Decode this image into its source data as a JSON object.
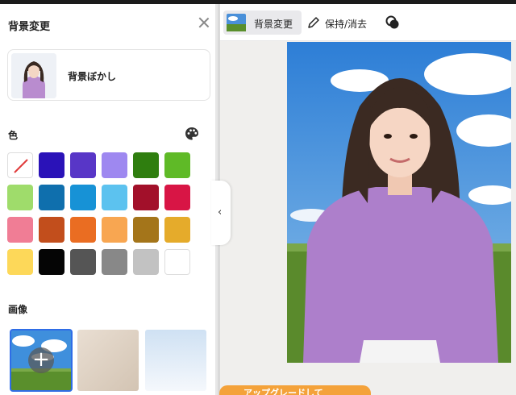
{
  "panel": {
    "title": "背景変更",
    "blur_label": "背景ぼかし",
    "color_label": "色",
    "image_label": "画像"
  },
  "swatches": [
    {
      "name": "none",
      "color": "#ffffff"
    },
    {
      "name": "dark-blue",
      "color": "#2a12b8"
    },
    {
      "name": "purple",
      "color": "#5836c7"
    },
    {
      "name": "lavender",
      "color": "#9e88f0"
    },
    {
      "name": "dark-green",
      "color": "#2f7e0f"
    },
    {
      "name": "green",
      "color": "#5fba27"
    },
    {
      "name": "light-green",
      "color": "#9fdc6b"
    },
    {
      "name": "steel-blue",
      "color": "#0f6fad"
    },
    {
      "name": "blue",
      "color": "#1792d6"
    },
    {
      "name": "sky-blue",
      "color": "#5cc2ef"
    },
    {
      "name": "dark-red",
      "color": "#a2102a"
    },
    {
      "name": "red",
      "color": "#d81545"
    },
    {
      "name": "pink",
      "color": "#f07d95"
    },
    {
      "name": "rust",
      "color": "#c24e1c"
    },
    {
      "name": "orange",
      "color": "#ea6d22"
    },
    {
      "name": "light-orange",
      "color": "#f8a651"
    },
    {
      "name": "ochre",
      "color": "#a4751a"
    },
    {
      "name": "gold",
      "color": "#e5ab2b"
    },
    {
      "name": "yellow",
      "color": "#fdd859"
    },
    {
      "name": "black",
      "color": "#050505"
    },
    {
      "name": "dark-gray",
      "color": "#555555"
    },
    {
      "name": "gray",
      "color": "#888888"
    },
    {
      "name": "light-gray",
      "color": "#c2c2c2"
    },
    {
      "name": "white",
      "color": "#ffffff"
    }
  ],
  "toolbar": {
    "change_bg_label": "背景変更",
    "keep_erase_label": "保持/消去"
  },
  "upgrade": {
    "label": "アップグレードして"
  }
}
